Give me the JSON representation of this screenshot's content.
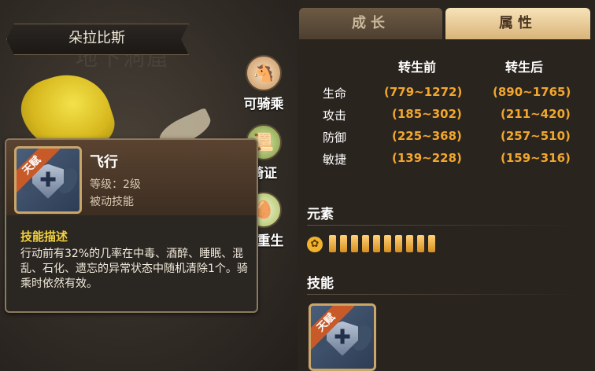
{
  "character": {
    "name": "朵拉比斯",
    "bg_location": "地下洞窟"
  },
  "side_actions": [
    {
      "label": "可骑乘",
      "icon": "horse-icon"
    },
    {
      "label": "骑证",
      "icon": "certificate-icon"
    },
    {
      "label": "可重生",
      "icon": "egg-icon"
    }
  ],
  "tooltip": {
    "badge": "天赋",
    "title": "飞行",
    "level": "等级：2级",
    "type": "被动技能",
    "desc_heading": "技能描述",
    "description": "行动前有32%的几率在中毒、酒醉、睡眠、混乱、石化、遗忘的异常状态中随机清除1个。骑乘时依然有效。"
  },
  "tabs": [
    {
      "label": "成长",
      "active": false
    },
    {
      "label": "属性",
      "active": true
    }
  ],
  "stats": {
    "col_before": "转生前",
    "col_after": "转生后",
    "rows": [
      {
        "label": "生命",
        "before": "(779~1272)",
        "after": "(890~1765)"
      },
      {
        "label": "攻击",
        "before": "(185~302)",
        "after": "(211~420)"
      },
      {
        "label": "防御",
        "before": "(225~368)",
        "after": "(257~510)"
      },
      {
        "label": "敏捷",
        "before": "(139~228)",
        "after": "(159~316)"
      }
    ]
  },
  "element": {
    "heading": "元素",
    "icon": "wind-element-icon",
    "level": 10
  },
  "skills": {
    "heading": "技能",
    "badge": "天赋"
  },
  "colors": {
    "accent_orange": "#f1a72e",
    "tab_active": "#e8c88e",
    "tab_inactive": "#5d4b39"
  }
}
